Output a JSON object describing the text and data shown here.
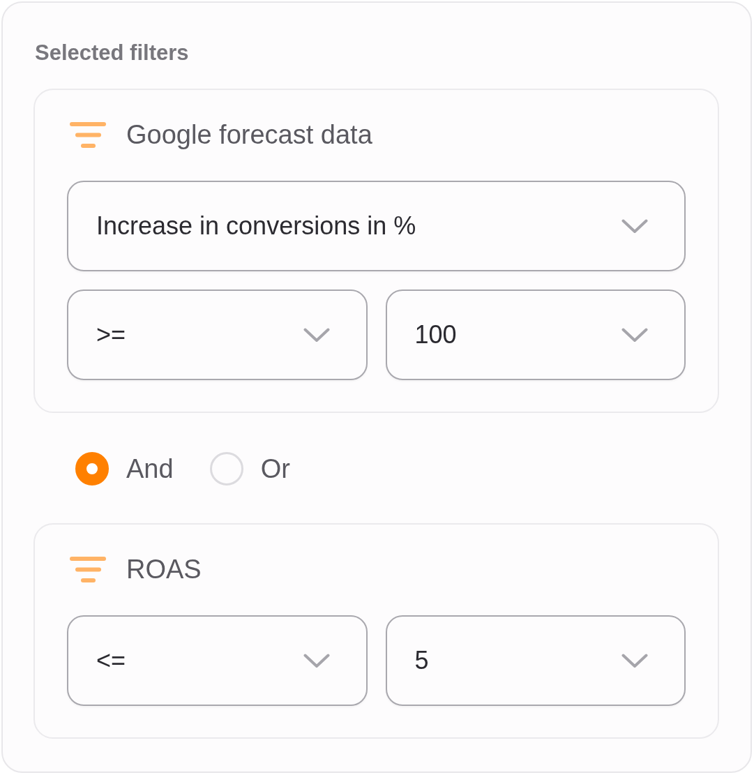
{
  "section": {
    "title": "Selected filters"
  },
  "blocks": [
    {
      "kind": "filter",
      "name": "Google forecast data",
      "rows": [
        {
          "dropdowns": [
            {
              "value": "Increase in conversions in %"
            }
          ]
        },
        {
          "dropdowns": [
            {
              "value": ">="
            },
            {
              "value": "100"
            }
          ]
        }
      ]
    },
    {
      "kind": "logic",
      "options": [
        {
          "label": "And",
          "selected": true
        },
        {
          "label": "Or",
          "selected": false
        }
      ]
    },
    {
      "kind": "filter",
      "name": "ROAS",
      "rows": [
        {
          "dropdowns": [
            {
              "value": "<="
            },
            {
              "value": "5"
            }
          ]
        }
      ]
    }
  ]
}
